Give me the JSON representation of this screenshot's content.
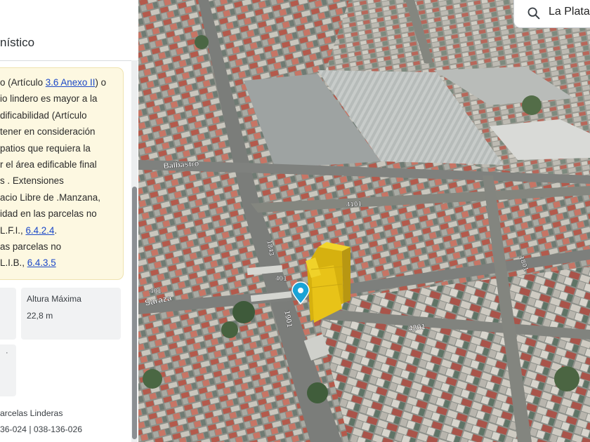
{
  "panel": {
    "title": "nístico",
    "note_lines": [
      {
        "before": "o (Artículo ",
        "link": "3.6 Anexo II",
        "after": ") o"
      },
      {
        "before": "io lindero es mayor a la",
        "link": "",
        "after": ""
      },
      {
        "before": "dificabilidad (Artículo",
        "link": "",
        "after": ""
      },
      {
        "before": " tener en consideración",
        "link": "",
        "after": ""
      },
      {
        "before": " patios que requiera la",
        "link": "",
        "after": ""
      },
      {
        "before": "r el área edificable final",
        "link": "",
        "after": ""
      },
      {
        "before": "s . Extensiones",
        "link": "",
        "after": ""
      },
      {
        "before": "acio Libre de .Manzana,",
        "link": "",
        "after": ""
      },
      {
        "before": "idad en las parcelas no",
        "link": "",
        "after": ""
      },
      {
        "before": " L.F.I., ",
        "link": "6.4.2.4",
        "after": "."
      },
      {
        "before": "as parcelas no",
        "link": "",
        "after": ""
      },
      {
        "before": " L.I.B., ",
        "link": "6.4.3.5",
        "after": ""
      }
    ],
    "cards": [
      {
        "label": "",
        "value": ""
      },
      {
        "label": "Altura Máxima",
        "value": "22,8 m"
      },
      {
        "label": "",
        "value": ""
      }
    ],
    "card_stub": "·",
    "parcels_label": "arcelas Linderas",
    "parcels_values": "36-024 | 038-136-026"
  },
  "search": {
    "icon": "search-icon",
    "text": "La Plata"
  },
  "map": {
    "street_labels": [
      "Balbastro",
      "Saraza",
      "4101",
      "4201",
      "1843",
      "1901",
      "1801",
      "401",
      "401"
    ],
    "building_color": "#e8c318",
    "marker_color": "#1aa3d6"
  }
}
